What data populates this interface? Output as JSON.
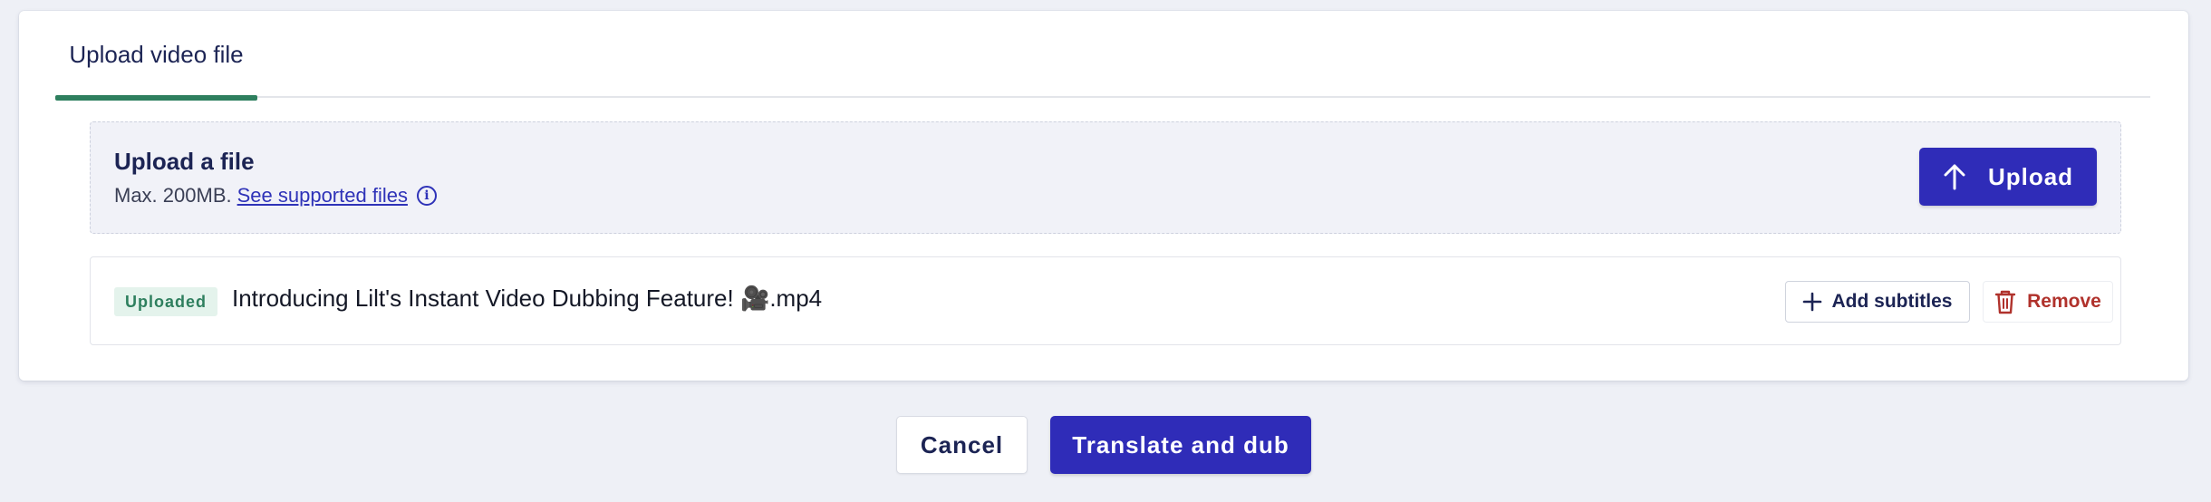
{
  "tabs": [
    {
      "label": "Upload video file",
      "active": true
    }
  ],
  "upload": {
    "title": "Upload a file",
    "max_size": "Max. 200MB.",
    "supported_link": "See supported files",
    "info_icon": "info-icon",
    "button_label": "Upload",
    "button_icon": "arrow-up-icon"
  },
  "file": {
    "status_badge": "Uploaded",
    "name": "Introducing Lilt's Instant Video Dubbing Feature! 🎥.mp4",
    "add_subtitles_label": "Add subtitles",
    "add_subtitles_icon": "plus-icon",
    "remove_label": "Remove",
    "remove_icon": "trash-icon"
  },
  "footer": {
    "cancel_label": "Cancel",
    "primary_label": "Translate and dub"
  },
  "colors": {
    "primary": "#2f2cb8",
    "tab_underline": "#2e7f5e",
    "badge_bg": "#e4f3ec",
    "badge_text": "#2e7f5e",
    "danger": "#b0322c",
    "link": "#2f33b8",
    "heading": "#1c2454"
  }
}
